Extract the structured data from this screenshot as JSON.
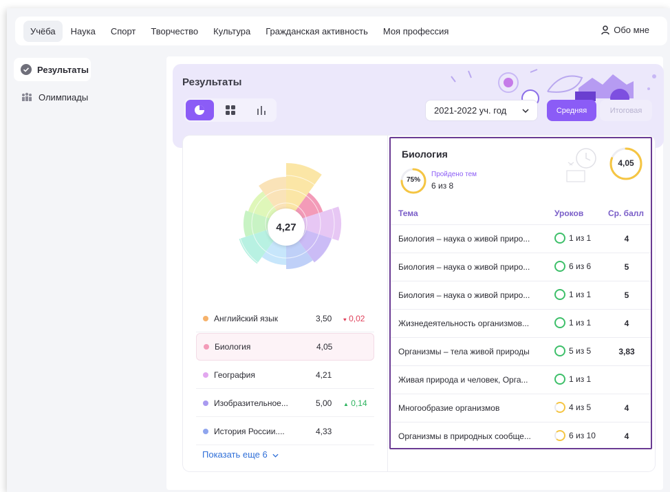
{
  "nav": {
    "items": [
      "Учёба",
      "Наука",
      "Спорт",
      "Творчество",
      "Культура",
      "Гражданская активность",
      "Моя профессия"
    ],
    "active": "Учёба",
    "about": "Обо мне"
  },
  "sidebar": {
    "items": [
      {
        "label": "Результаты",
        "active": true
      },
      {
        "label": "Олимпиады",
        "active": false
      }
    ]
  },
  "results": {
    "title": "Результаты",
    "year": "2021-2022 уч. год",
    "avg_button": "Средняя",
    "final_button": "Итоговая"
  },
  "chart": {
    "center_value": "4,27",
    "segment_colors": [
      "#fbe6a6",
      "#f39bb8",
      "#e7c7f4",
      "#cbbcf6",
      "#bfd0f8",
      "#c7e6fb",
      "#b8f1e2",
      "#c8f3c4",
      "#dff7b9",
      "#fae3b8"
    ]
  },
  "subjects": [
    {
      "name": "Английский язык",
      "score": "3,50",
      "delta": "0,02",
      "trend": "down",
      "color": "#f6b26b"
    },
    {
      "name": "Биология",
      "score": "4,05",
      "delta": "",
      "trend": "",
      "color": "#f39bb8"
    },
    {
      "name": "География",
      "score": "4,21",
      "delta": "",
      "trend": "",
      "color": "#e2a7ef"
    },
    {
      "name": "Изобразительное...",
      "score": "5,00",
      "delta": "0,14",
      "trend": "up",
      "color": "#a99af0"
    },
    {
      "name": "История России....",
      "score": "4,33",
      "delta": "",
      "trend": "",
      "color": "#8fa5ee"
    }
  ],
  "show_more": "Показать еще 6",
  "detail": {
    "title": "Биология",
    "progress_percent": "75%",
    "progress_fraction": 0.75,
    "passed_label": "Пройдено тем",
    "passed_value": "6 из 8",
    "avg_score": "4,05",
    "avg_fraction": 0.81,
    "headers": {
      "topic": "Тема",
      "lessons": "Уроков",
      "avg": "Ср. балл"
    },
    "rows": [
      {
        "topic": "Биология – наука о живой приро...",
        "lessons": "1 из 1",
        "avg": "4",
        "done": true
      },
      {
        "topic": "Биология – наука о живой приро...",
        "lessons": "6 из 6",
        "avg": "5",
        "done": true
      },
      {
        "topic": "Биология – наука о живой приро...",
        "lessons": "1 из 1",
        "avg": "5",
        "done": true
      },
      {
        "topic": "Жизнедеятельность организмов...",
        "lessons": "1 из 1",
        "avg": "4",
        "done": true
      },
      {
        "topic": "Организмы – тела живой природы",
        "lessons": "5 из 5",
        "avg": "3,83",
        "done": true
      },
      {
        "topic": "Живая природа и человек, Орга...",
        "lessons": "1 из 1",
        "avg": "",
        "done": true
      },
      {
        "topic": "Многообразие организмов",
        "lessons": "4 из 5",
        "avg": "4",
        "done": false
      },
      {
        "topic": "Организмы в природных сообще...",
        "lessons": "6 из 10",
        "avg": "4",
        "done": false
      }
    ]
  }
}
